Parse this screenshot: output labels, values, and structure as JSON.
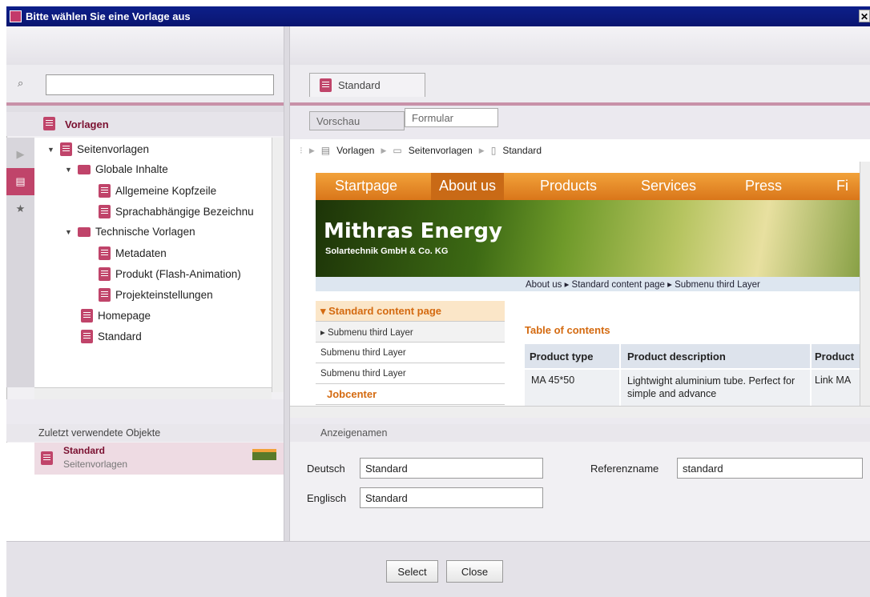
{
  "window": {
    "title": "Bitte wählen Sie eine Vorlage aus",
    "close_glyph": "✕"
  },
  "left": {
    "search": {
      "placeholder": "",
      "value": ""
    },
    "tree_header": "Vorlagen",
    "tree": [
      {
        "label": "Seitenvorlagen",
        "type": "doc",
        "expanded": true
      },
      {
        "label": "Globale Inhalte",
        "type": "folder",
        "expanded": true
      },
      {
        "label": "Allgemeine Kopfzeile",
        "type": "doc"
      },
      {
        "label": "Sprachabhängige Bezeichnu",
        "type": "doc"
      },
      {
        "label": "Technische Vorlagen",
        "type": "folder",
        "expanded": true
      },
      {
        "label": "Metadaten",
        "type": "doc"
      },
      {
        "label": "Produkt (Flash-Animation)",
        "type": "doc"
      },
      {
        "label": "Projekteinstellungen",
        "type": "doc"
      },
      {
        "label": "Homepage",
        "type": "doc"
      },
      {
        "label": "Standard",
        "type": "doc"
      }
    ],
    "recent_header": "Zuletzt verwendete Objekte",
    "recent_item": {
      "title": "Standard",
      "subtitle": "Seitenvorlagen"
    }
  },
  "right": {
    "tab_label": "Standard",
    "subtabs": {
      "preview": "Vorschau",
      "form": "Formular"
    },
    "breadcrumb": [
      "Vorlagen",
      "Seitenvorlagen",
      "Standard"
    ],
    "preview": {
      "nav": [
        "Startpage",
        "About us",
        "Products",
        "Services",
        "Press",
        "Fi"
      ],
      "brand": "Mithras Energy",
      "brand_sub": "Solartechnik GmbH & Co. KG",
      "crumbs": "About us ▸ Standard content page ▸ Submenu third Layer",
      "menu_title": "▾ Standard content page",
      "menu_items": [
        "▸ Submenu third Layer",
        "Submenu third Layer",
        "Submenu third Layer"
      ],
      "menu_jobcenter": "Jobcenter",
      "toc_title": "Table of contents",
      "table_headers": [
        "Product type",
        "Product description",
        "Product"
      ],
      "table_row": [
        "MA 45*50",
        "Lightwight aluminium tube. Perfect for simple and advance",
        "Link MA"
      ]
    },
    "names_header": "Anzeigenamen",
    "fields": {
      "deutsch_label": "Deutsch",
      "deutsch_value": "Standard",
      "englisch_label": "Englisch",
      "englisch_value": "Standard",
      "ref_label": "Referenzname",
      "ref_value": "standard"
    }
  },
  "buttons": {
    "select": "Select",
    "close": "Close"
  },
  "colors": {
    "accent": "#c0446a",
    "titlebar": "#0d1f8a",
    "orange": "#e8861f"
  }
}
